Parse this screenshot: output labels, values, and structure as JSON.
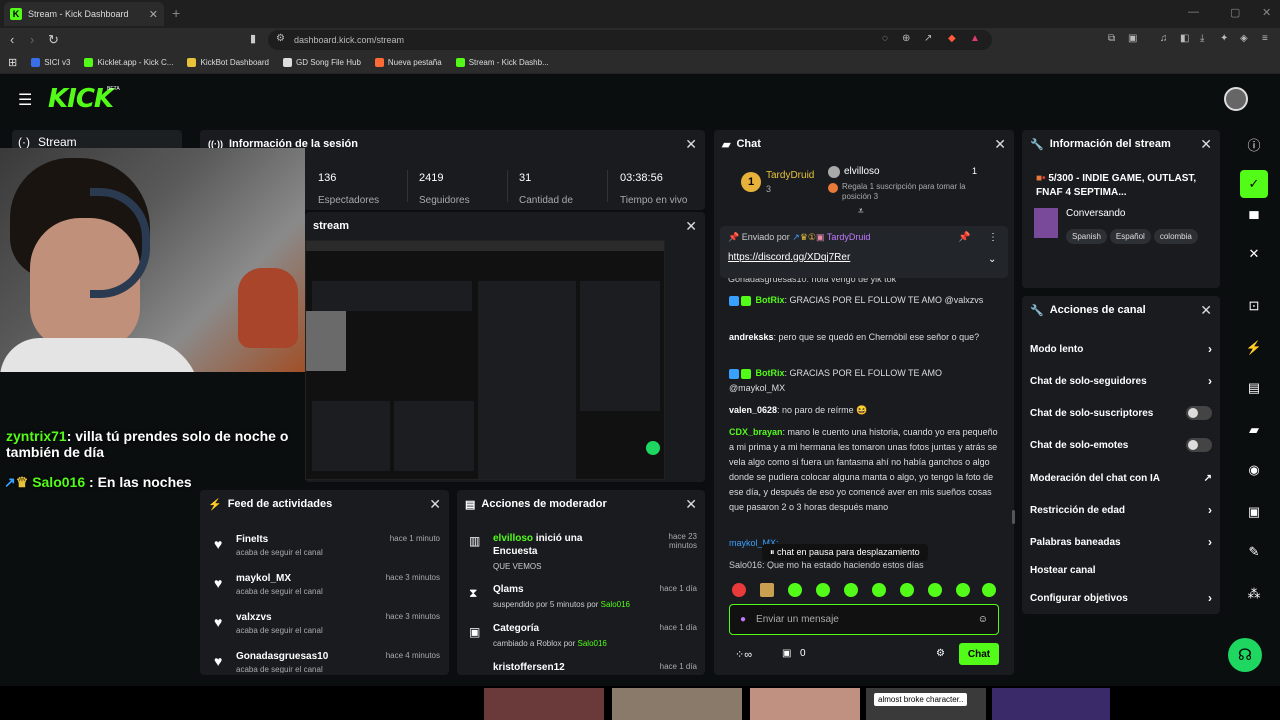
{
  "browser": {
    "tab_title": "Stream - Kick Dashboard",
    "url": "dashboard.kick.com/stream",
    "bookmarks": [
      {
        "label": "SICI v3",
        "color": "#3a6ee8"
      },
      {
        "label": "Kicklet.app - Kick C...",
        "color": "#53fc18"
      },
      {
        "label": "KickBot Dashboard",
        "color": "#e8c23a"
      },
      {
        "label": "GD Song File Hub",
        "color": "#ddd"
      },
      {
        "label": "Nueva pestaña",
        "color": "#ff6b35"
      },
      {
        "label": "Stream - Kick Dashb...",
        "color": "#53fc18"
      }
    ]
  },
  "header": {
    "logo": "KICK",
    "beta": "BETA"
  },
  "sidebar": {
    "stream_label": "Stream"
  },
  "overlay_chat": [
    {
      "user": "zyntrix71",
      "text": ": villa tú prendes solo de noche o también de día"
    },
    {
      "user": "Salo016",
      "text": ": En las noches"
    }
  ],
  "session": {
    "title": "Información de la sesión",
    "stats": [
      {
        "value": "136",
        "label": "Espectadores"
      },
      {
        "value": "2419",
        "label": "Seguidores"
      },
      {
        "value": "31",
        "label": "Cantidad de"
      },
      {
        "value": "03:38:56",
        "label": "Tiempo en vivo"
      }
    ]
  },
  "stream_preview": {
    "title": "stream"
  },
  "feed": {
    "title": "Feed de actividades",
    "items": [
      {
        "name": "FineIts",
        "sub": "acaba de seguir el canal",
        "time": "hace 1 minuto"
      },
      {
        "name": "maykol_MX",
        "sub": "acaba de seguir el canal",
        "time": "hace 3 minutos"
      },
      {
        "name": "valxzvs",
        "sub": "acaba de seguir el canal",
        "time": "hace 3 minutos"
      },
      {
        "name": "Gonadasgruesas10",
        "sub": "acaba de seguir el canal",
        "time": "hace 4 minutos"
      }
    ]
  },
  "mod": {
    "title": "Acciones de moderador",
    "items": [
      {
        "name_user": "elvilloso",
        "name_rest": " inició una Encuesta",
        "sub": "QUE VEMOS",
        "time": "hace 23 minutos"
      },
      {
        "name_user": "",
        "name_rest": "Qlams",
        "sub": "suspendido por 5 minutos por ",
        "sub_user": "Salo016",
        "time": "hace 1 día"
      },
      {
        "name_user": "",
        "name_rest": "Categoría",
        "sub": "cambiado a Roblox por ",
        "sub_user": "Salo016",
        "time": "hace 1 día"
      },
      {
        "name_user": "",
        "name_rest": "kristoffersen12",
        "sub": "",
        "sub_user": "",
        "time": "hace 1 día"
      }
    ]
  },
  "chat": {
    "title": "Chat",
    "top_gifter": {
      "name": "TardyDruid",
      "rank": "3"
    },
    "gift": {
      "name": "elvilloso",
      "count": "1",
      "text": "Regala 1 suscripción para tomar la posición 3"
    },
    "pinned": {
      "by": "Enviado por",
      "user": "TardyDruid",
      "link": "https://discord.gg/XDqj7Rer"
    },
    "partial_top": "Gonadasgruesas10: hola vengo de yik tok",
    "messages": [
      {
        "user": "BotRix",
        "user_color": "#53fc18",
        "text": ": GRACIAS POR EL FOLLOW TE AMO @valxzvs"
      },
      {
        "user": "andreksks",
        "user_color": "#ffffff",
        "text": ": pero que se quedó en Chernóbil ese señor o que?"
      },
      {
        "user": "BotRix",
        "user_color": "#53fc18",
        "text": ": GRACIAS POR EL FOLLOW TE AMO @maykol_MX"
      },
      {
        "user": "valen_0628",
        "user_color": "#ffffff",
        "text": ": no paro de reírme 😆"
      },
      {
        "user": "CDX_brayan",
        "user_color": "#53fc18",
        "text": ": mano le cuento una historia, cuando yo era pequeño a mi prima y a mi hermana les tomaron unas fotos juntas y atrás se vela algo como si fuera un fantasma ahí no había ganchos o algo donde se pudiera colocar alguna manta o algo, yo tengo la foto de ese día, y después de eso yo comencé aver en mis sueños cosas que pasaron 2 o 3 horas después mano"
      }
    ],
    "partial_bottom_1": "maykol_MX: ",
    "partial_bottom_2": "Salo016: Que mo ha estado haciendo estos días",
    "paused": "chat en pausa para desplazamiento",
    "input_placeholder": "Enviar un mensaje",
    "points": "0",
    "send": "Chat"
  },
  "stream_info": {
    "title": "Información del stream",
    "stream_title": "5/300 - INDIE GAME, OUTLAST, FNAF 4 SEPTIMA...",
    "category": "Conversando",
    "tags": [
      "Spanish",
      "Español",
      "colombia"
    ]
  },
  "channel_actions": {
    "title": "Acciones de canal",
    "items": [
      {
        "label": "Modo lento",
        "kind": "chevron"
      },
      {
        "label": "Chat de solo-seguidores",
        "kind": "chevron"
      },
      {
        "label": "Chat de solo-suscriptores",
        "kind": "toggle"
      },
      {
        "label": "Chat de solo-emotes",
        "kind": "toggle"
      },
      {
        "label": "Moderación del chat con IA",
        "kind": "external"
      },
      {
        "label": "Restricción de edad",
        "kind": "chevron"
      },
      {
        "label": "Palabras baneadas",
        "kind": "chevron"
      },
      {
        "label": "Hostear canal",
        "kind": "none"
      },
      {
        "label": "Configurar objetivos",
        "kind": "chevron"
      }
    ]
  },
  "bottom": {
    "tooltip": "almost broke character.."
  }
}
